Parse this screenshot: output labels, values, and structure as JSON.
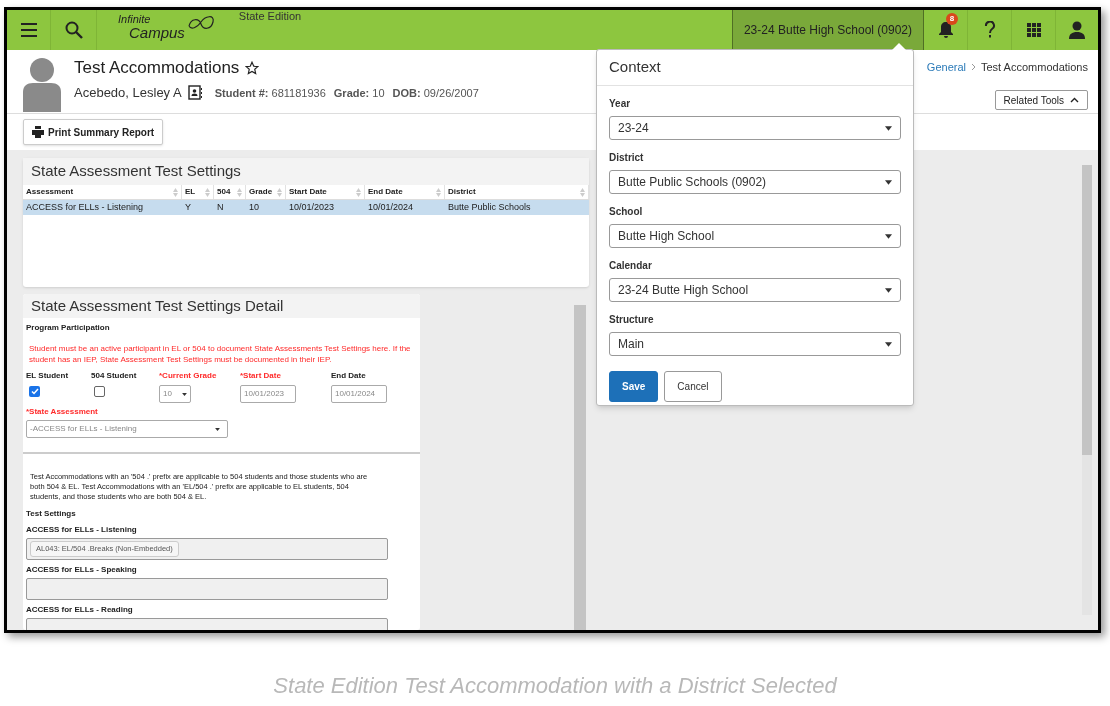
{
  "header": {
    "edition": "State Edition",
    "logo_line1": "Infinite",
    "logo_line2": "Campus",
    "context_button": "23-24 Butte High School (0902)",
    "notification_count": "8"
  },
  "page": {
    "title": "Test Accommodations",
    "starred": false,
    "student_name": "Acebedo, Lesley A",
    "student_info": [
      {
        "label": "Student #:",
        "value": "681181936"
      },
      {
        "label": "Grade:",
        "value": "10"
      },
      {
        "label": "DOB:",
        "value": "09/26/2007"
      }
    ],
    "print_button": "Print Summary Report",
    "breadcrumb": [
      "General",
      "Test Accommodations"
    ],
    "related_tools": "Related Tools"
  },
  "settings_table": {
    "title": "State Assessment Test Settings",
    "columns": [
      "Assessment",
      "EL",
      "504",
      "Grade",
      "Start Date",
      "End Date",
      "District"
    ],
    "rows": [
      {
        "cells": [
          "ACCESS for ELLs - Listening",
          "Y",
          "N",
          "10",
          "10/01/2023",
          "10/01/2024",
          "Butte Public Schools"
        ],
        "selected": true
      }
    ]
  },
  "detail": {
    "title": "State Assessment Test Settings Detail",
    "section": "Program Participation",
    "warning": "Student must be an active participant in EL or 504 to document State Assessments Test Settings here. If the student has an IEP, State Assessment Test Settings must be documented in their IEP.",
    "fields": [
      {
        "kind": "checkbox",
        "label": "EL Student",
        "required": false,
        "checked": true
      },
      {
        "kind": "checkbox",
        "label": "504 Student",
        "required": false,
        "checked": false
      },
      {
        "kind": "select",
        "label": "*Current Grade",
        "required": true,
        "value": "10",
        "disabled": true
      },
      {
        "kind": "date",
        "label": "*Start Date",
        "required": true,
        "value": "10/01/2023",
        "disabled": true
      },
      {
        "kind": "date",
        "label": "End Date",
        "required": false,
        "value": "10/01/2024",
        "disabled": true
      }
    ],
    "assessment": {
      "label": "*State Assessment",
      "required": true,
      "value": "-ACCESS for ELLs - Listening",
      "disabled": true
    },
    "note": "Test Accommodations with an '504 .' prefix are applicable to 504 students and those students who are both 504 & EL. Test Accommodations with an 'EL/504 .' prefix are applicable to EL students, 504 students, and those students who are both 504 & EL.",
    "test_settings_heading": "Test Settings",
    "test_settings": [
      {
        "label": "ACCESS for ELLs - Listening",
        "tags": [
          "AL043: EL/504 .Breaks (Non-Embedded)"
        ]
      },
      {
        "label": "ACCESS for ELLs - Speaking"
      },
      {
        "label": "ACCESS for ELLs - Reading"
      }
    ]
  },
  "context_panel": {
    "title": "Context",
    "fields": [
      {
        "label": "Year",
        "value": "23-24"
      },
      {
        "label": "District",
        "value": "Butte Public Schools (0902)"
      },
      {
        "label": "School",
        "value": "Butte High School"
      },
      {
        "label": "Calendar",
        "value": "23-24 Butte High School"
      },
      {
        "label": "Structure",
        "value": "Main"
      }
    ],
    "buttons": [
      {
        "label": "Save",
        "kind": "primary"
      },
      {
        "label": "Cancel",
        "kind": "secondary"
      }
    ]
  },
  "caption": "State Edition Test Accommodation with a District Selected"
}
